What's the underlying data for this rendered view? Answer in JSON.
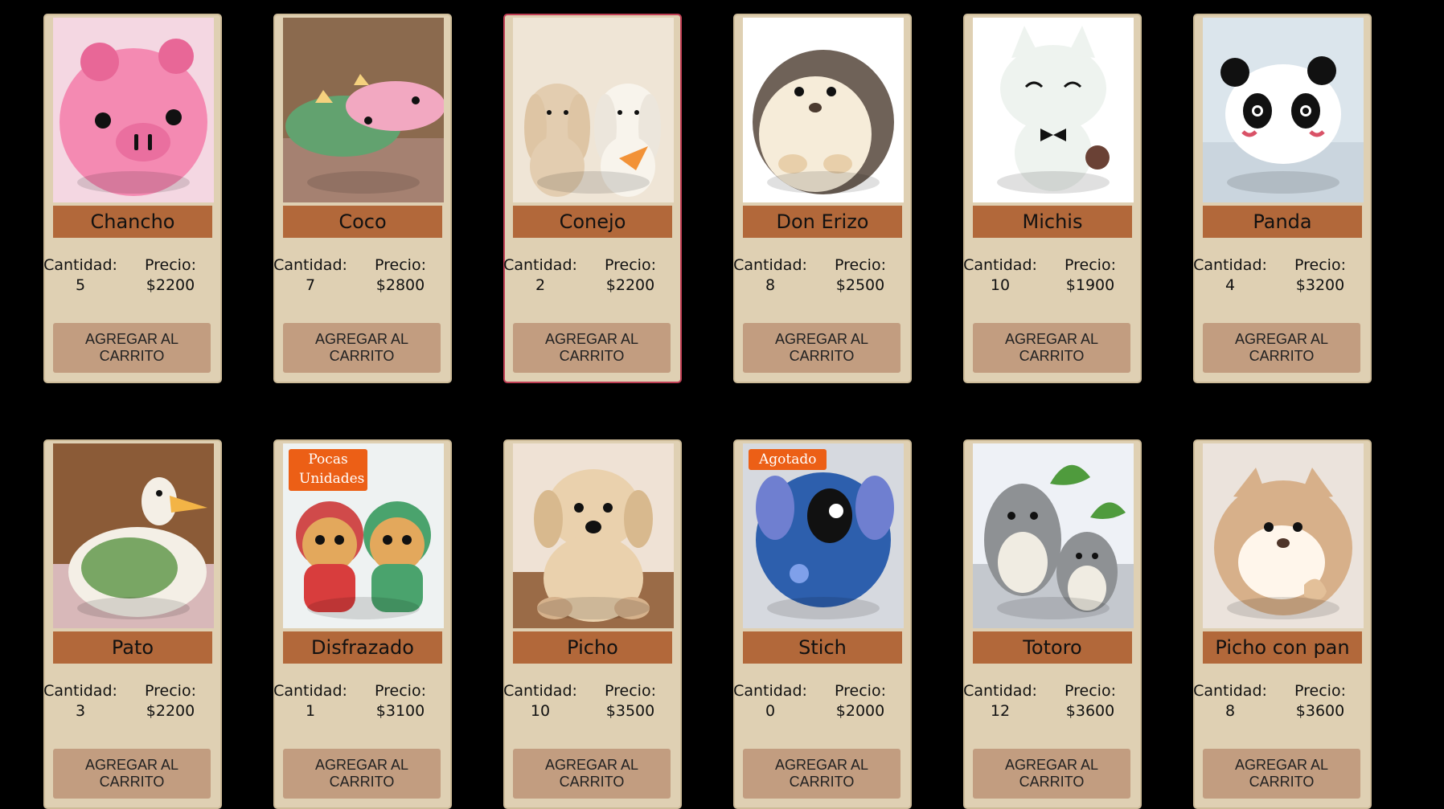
{
  "products": [
    {
      "name": "Chancho",
      "quantity_label": "Cantidad:",
      "quantity": "5",
      "price_label": "Precio:",
      "price": "$2200",
      "button": "AGREGAR AL CARRITO",
      "badge": "",
      "icon": "pig-plush",
      "bg": "#f4d7e2",
      "fg": "#f48ab2",
      "accent": "#e86797"
    },
    {
      "name": "Coco",
      "quantity_label": "Cantidad:",
      "quantity": "7",
      "price_label": "Precio:",
      "price": "$2800",
      "button": "AGREGAR AL CARRITO",
      "badge": "",
      "icon": "dinosaur-plush",
      "bg": "#8b6a4e",
      "fg": "#62a26f",
      "accent": "#f2a8c1"
    },
    {
      "name": "Conejo",
      "quantity_label": "Cantidad:",
      "quantity": "2",
      "price_label": "Precio:",
      "price": "$2200",
      "button": "AGREGAR AL CARRITO",
      "badge": "",
      "icon": "bunny-plush",
      "bg": "#efe5d6",
      "fg": "#e8d8c2",
      "accent": "#f29237"
    },
    {
      "name": "Don Erizo",
      "quantity_label": "Cantidad:",
      "quantity": "8",
      "price_label": "Precio:",
      "price": "$2500",
      "button": "AGREGAR AL CARRITO",
      "badge": "",
      "icon": "hedgehog-plush",
      "bg": "#ffffff",
      "fg": "#f6ecd9",
      "accent": "#6f6258"
    },
    {
      "name": "Michis",
      "quantity_label": "Cantidad:",
      "quantity": "10",
      "price_label": "Precio:",
      "price": "$1900",
      "button": "AGREGAR AL CARRITO",
      "badge": "",
      "icon": "cat-plush",
      "bg": "#ffffff",
      "fg": "#eef3ef",
      "accent": "#6a4135"
    },
    {
      "name": "Panda",
      "quantity_label": "Cantidad:",
      "quantity": "4",
      "price_label": "Precio:",
      "price": "$3200",
      "button": "AGREGAR AL CARRITO",
      "badge": "",
      "icon": "panda-plush",
      "bg": "#dbe5ec",
      "fg": "#ffffff",
      "accent": "#111111"
    },
    {
      "name": "Pato",
      "quantity_label": "Cantidad:",
      "quantity": "3",
      "price_label": "Precio:",
      "price": "$2200",
      "button": "AGREGAR AL CARRITO",
      "badge": "",
      "icon": "duck-plush",
      "bg": "#8b5b37",
      "fg": "#f4efe6",
      "accent": "#79a664"
    },
    {
      "name": "Disfrazado",
      "quantity_label": "Cantidad:",
      "quantity": "1",
      "price_label": "Precio:",
      "price": "$3100",
      "button": "AGREGAR AL CARRITO",
      "badge": "Pocas Unidades",
      "icon": "costume-plush",
      "bg": "#eef2f2",
      "fg": "#e3a85c",
      "accent": "#d83d3d"
    },
    {
      "name": "Picho",
      "quantity_label": "Cantidad:",
      "quantity": "10",
      "price_label": "Precio:",
      "price": "$3500",
      "button": "AGREGAR AL CARRITO",
      "badge": "",
      "icon": "dog-plush",
      "bg": "#efe2d5",
      "fg": "#ead1ad",
      "accent": "#5b7f4a"
    },
    {
      "name": "Stich",
      "quantity_label": "Cantidad:",
      "quantity": "0",
      "price_label": "Precio:",
      "price": "$2000",
      "button": "AGREGAR AL CARRITO",
      "badge": "Agotado",
      "icon": "stitch-plush",
      "bg": "#d6d9df",
      "fg": "#2d5fad",
      "accent": "#111111"
    },
    {
      "name": "Totoro",
      "quantity_label": "Cantidad:",
      "quantity": "12",
      "price_label": "Precio:",
      "price": "$3600",
      "button": "AGREGAR AL CARRITO",
      "badge": "",
      "icon": "totoro-plush",
      "bg": "#eef1f6",
      "fg": "#8e9194",
      "accent": "#4f9b3d"
    },
    {
      "name": "Picho con pan",
      "quantity_label": "Cantidad:",
      "quantity": "8",
      "price_label": "Precio:",
      "price": "$3600",
      "button": "AGREGAR AL CARRITO",
      "badge": "",
      "icon": "corgi-plush",
      "bg": "#ebe3dc",
      "fg": "#d7b08a",
      "accent": "#fff6eb"
    }
  ],
  "colors": {
    "page_bg": "#000000",
    "card_bg": "#dfd0b3",
    "name_bar": "#b2683a",
    "button_bg": "#c29d80",
    "badge_bg": "#ec5f16",
    "selected_border": "#c03f55"
  }
}
